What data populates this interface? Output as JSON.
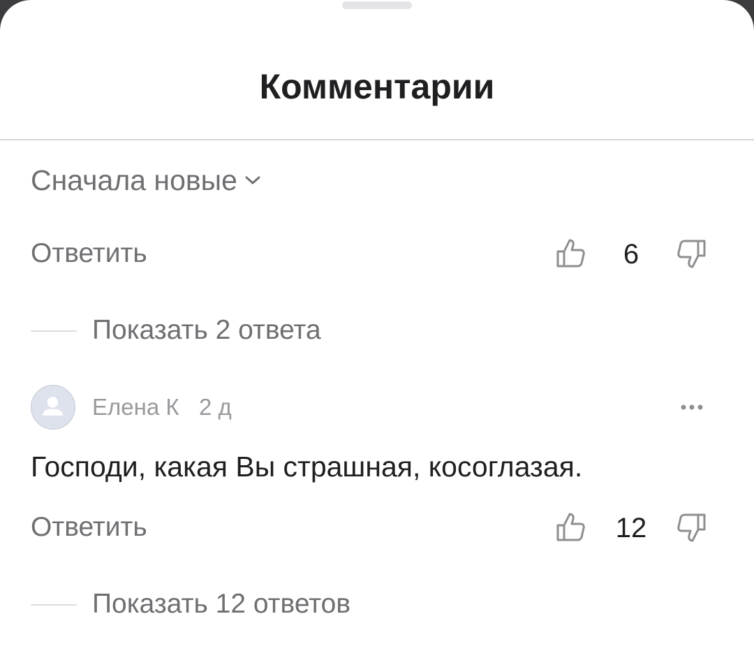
{
  "sheet": {
    "title": "Комментарии"
  },
  "sort": {
    "label": "Сначала новые",
    "icon": "chevron-down-icon"
  },
  "comments": [
    {
      "reply_label": "Ответить",
      "likes": "6",
      "replies_label": "Показать 2 ответа"
    },
    {
      "author": "Елена К",
      "time": "2 д",
      "text": "Господи, какая Вы страшная, косоглазая.",
      "reply_label": "Ответить",
      "likes": "12",
      "replies_label": "Показать 12 ответов"
    }
  ],
  "icons": {
    "like": "thumbs-up-icon",
    "dislike": "thumbs-down-icon",
    "more": "more-dots-icon",
    "avatar": "user-avatar-icon"
  },
  "colors": {
    "title": "#1f1f22",
    "secondary_text": "#6f6f73",
    "meta_text": "#9a9a9e",
    "icon_gray": "#8e8e92",
    "divider": "#d6d6d8"
  }
}
